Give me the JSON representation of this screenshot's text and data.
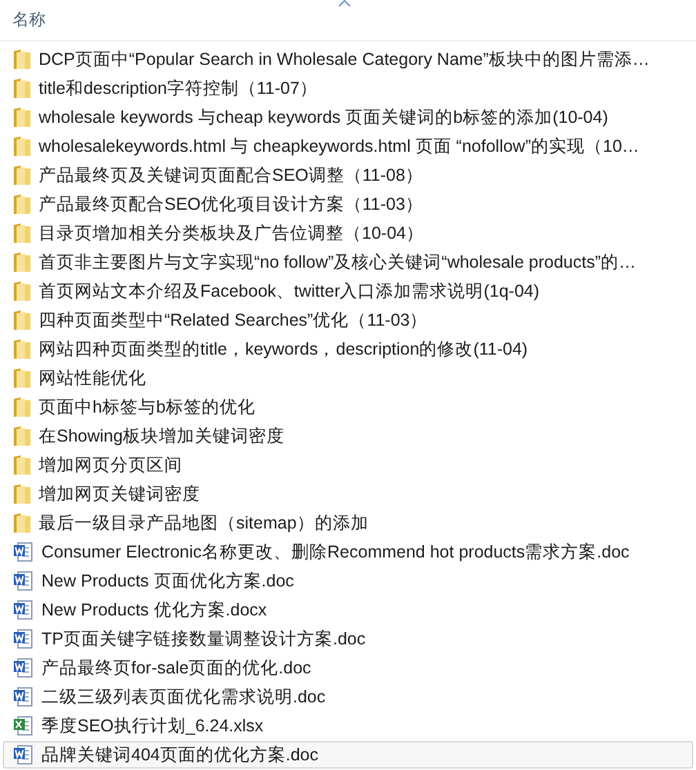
{
  "header": {
    "column_name": "名称",
    "sort_ascending": true
  },
  "items": [
    {
      "name": "DCP页面中“Popular Search in Wholesale Category Name”板块中的图片需添…",
      "kind": "folder",
      "selected": false
    },
    {
      "name": "title和description字符控制（11-07）",
      "kind": "folder",
      "selected": false
    },
    {
      "name": "wholesale keywords 与cheap keywords 页面关键词的b标签的添加(10-04)",
      "kind": "folder",
      "selected": false
    },
    {
      "name": "wholesalekeywords.html 与 cheapkeywords.html 页面 “nofollow”的实现（10…",
      "kind": "folder",
      "selected": false
    },
    {
      "name": "产品最终页及关键词页面配合SEO调整（11-08）",
      "kind": "folder",
      "selected": false
    },
    {
      "name": "产品最终页配合SEO优化项目设计方案（11-03）",
      "kind": "folder",
      "selected": false
    },
    {
      "name": "目录页增加相关分类板块及广告位调整（10-04）",
      "kind": "folder",
      "selected": false
    },
    {
      "name": "首页非主要图片与文字实现“no follow”及核心关键词“wholesale products”的…",
      "kind": "folder",
      "selected": false
    },
    {
      "name": "首页网站文本介绍及Facebook、twitter入口添加需求说明(1q-04)",
      "kind": "folder",
      "selected": false
    },
    {
      "name": "四种页面类型中“Related Searches”优化（11-03）",
      "kind": "folder",
      "selected": false
    },
    {
      "name": "网站四种页面类型的title，keywords，description的修改(11-04)",
      "kind": "folder",
      "selected": false
    },
    {
      "name": "网站性能优化",
      "kind": "folder",
      "selected": false
    },
    {
      "name": "页面中h标签与b标签的优化",
      "kind": "folder",
      "selected": false
    },
    {
      "name": "在Showing板块增加关键词密度",
      "kind": "folder",
      "selected": false
    },
    {
      "name": "增加网页分页区间",
      "kind": "folder",
      "selected": false
    },
    {
      "name": "增加网页关键词密度",
      "kind": "folder",
      "selected": false
    },
    {
      "name": "最后一级目录产品地图（sitemap）的添加",
      "kind": "folder",
      "selected": false
    },
    {
      "name": "Consumer Electronic名称更改、删除Recommend hot products需求方案.doc",
      "kind": "word",
      "selected": false
    },
    {
      "name": "New Products 页面优化方案.doc",
      "kind": "word",
      "selected": false
    },
    {
      "name": "New Products 优化方案.docx",
      "kind": "word",
      "selected": false
    },
    {
      "name": "TP页面关键字链接数量调整设计方案.doc",
      "kind": "word",
      "selected": false
    },
    {
      "name": "产品最终页for-sale页面的优化.doc",
      "kind": "word",
      "selected": false
    },
    {
      "name": "二级三级列表页面优化需求说明.doc",
      "kind": "word",
      "selected": false
    },
    {
      "name": "季度SEO执行计划_6.24.xlsx",
      "kind": "excel",
      "selected": false
    },
    {
      "name": "品牌关键词404页面的优化方案.doc",
      "kind": "word",
      "selected": true
    }
  ]
}
